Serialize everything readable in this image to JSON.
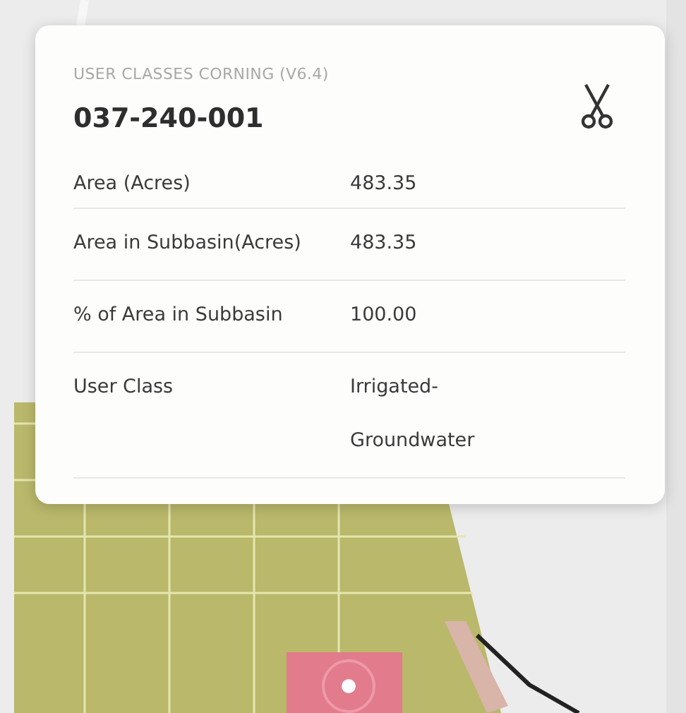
{
  "popup": {
    "layer": "USER CLASSES CORNING (V6.4)",
    "parcel_id": "037-240-001",
    "rows": [
      {
        "label": "Area (Acres)",
        "value": "483.35"
      },
      {
        "label": "Area in Subbasin(Acres)",
        "value": "483.35"
      },
      {
        "label": "% of Area in Subbasin",
        "value": "100.00"
      },
      {
        "label": "User Class",
        "value": "Irrigated-Groundwater"
      }
    ]
  }
}
